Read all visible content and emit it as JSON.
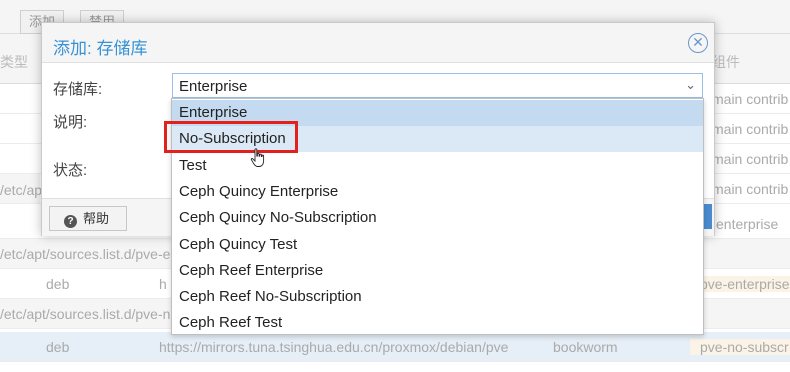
{
  "background": {
    "toolbar_buttons": [
      "添加",
      "禁用"
    ],
    "header_cols": [
      "类型",
      "组件"
    ],
    "rows": [
      {
        "kind": "item",
        "type": "",
        "uri": "",
        "suite": "",
        "components": "main contrib n"
      },
      {
        "kind": "item",
        "type": "",
        "uri": "",
        "suite": "",
        "components": "main contrib n"
      },
      {
        "kind": "item",
        "type": "",
        "uri": "",
        "suite": "",
        "components": "main contrib n"
      },
      {
        "kind": "item",
        "type": "",
        "uri": "",
        "suite": "",
        "components": "main contrib n"
      },
      {
        "kind": "group",
        "label": "/etc/apt/"
      },
      {
        "kind": "item",
        "type": "",
        "uri": "",
        "suite": "",
        "components": "enterprise"
      },
      {
        "kind": "group",
        "label": "/etc/apt/sources.list.d/pve-e"
      },
      {
        "kind": "item",
        "type": "deb",
        "uri": "h",
        "suite": "",
        "components": "pve-enterprise"
      },
      {
        "kind": "group",
        "label": "/etc/apt/sources.list.d/pve-no"
      },
      {
        "kind": "item",
        "type": "deb",
        "uri": "https://mirrors.tuna.tsinghua.edu.cn/proxmox/debian/pve",
        "suite": "bookworm",
        "components": "pve-no-subscr"
      }
    ]
  },
  "dialog": {
    "title": "添加: 存储库",
    "close_icon": "close-circle-icon",
    "fields": {
      "repository_label": "存储库:",
      "description_label": "说明:",
      "status_label": "状态:"
    },
    "combo_value": "Enterprise",
    "help_label": "帮助",
    "options": [
      "Enterprise",
      "No-Subscription",
      "Test",
      "Ceph Quincy Enterprise",
      "Ceph Quincy No-Subscription",
      "Ceph Quincy Test",
      "Ceph Reef Enterprise",
      "Ceph Reef No-Subscription",
      "Ceph Reef Test"
    ],
    "selected_index": 0,
    "hover_index": 1
  },
  "colors": {
    "accent": "#3892d4",
    "highlight": "#e3211c",
    "selected": "#c3daf0",
    "hover": "#dbe8f5"
  }
}
